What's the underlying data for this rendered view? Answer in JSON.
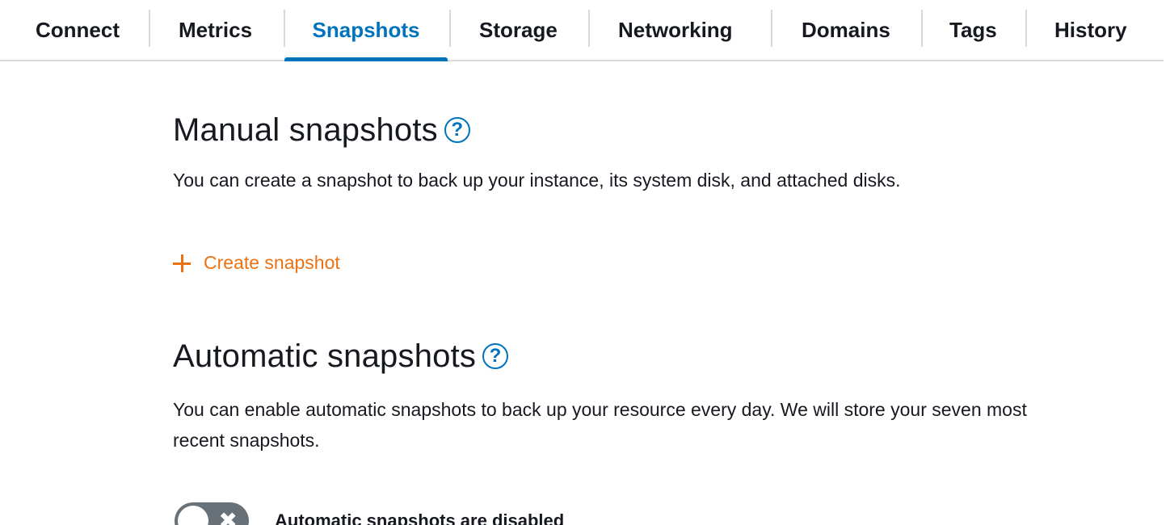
{
  "tabs": [
    {
      "label": "Connect"
    },
    {
      "label": "Metrics"
    },
    {
      "label": "Snapshots",
      "active": true
    },
    {
      "label": "Storage"
    },
    {
      "label": "Networking"
    },
    {
      "label": "Domains"
    },
    {
      "label": "Tags"
    },
    {
      "label": "History"
    }
  ],
  "manual": {
    "title": "Manual snapshots",
    "help_icon": "?",
    "description": "You can create a snapshot to back up your instance, its system disk, and attached disks.",
    "create_label": "Create snapshot"
  },
  "automatic": {
    "title": "Automatic snapshots",
    "help_icon": "?",
    "description": "You can enable automatic snapshots to back up your resource every day. We will store your seven most recent snapshots.",
    "toggle_state": "off",
    "toggle_glyph": "✖",
    "status_label": "Automatic snapshots are disabled"
  },
  "colors": {
    "accent_blue": "#0073bb",
    "action_orange": "#ec7211",
    "toggle_off": "#687078"
  },
  "icons": {
    "help": "question-circle-icon",
    "add": "plus-icon",
    "toggle": "x-icon"
  }
}
